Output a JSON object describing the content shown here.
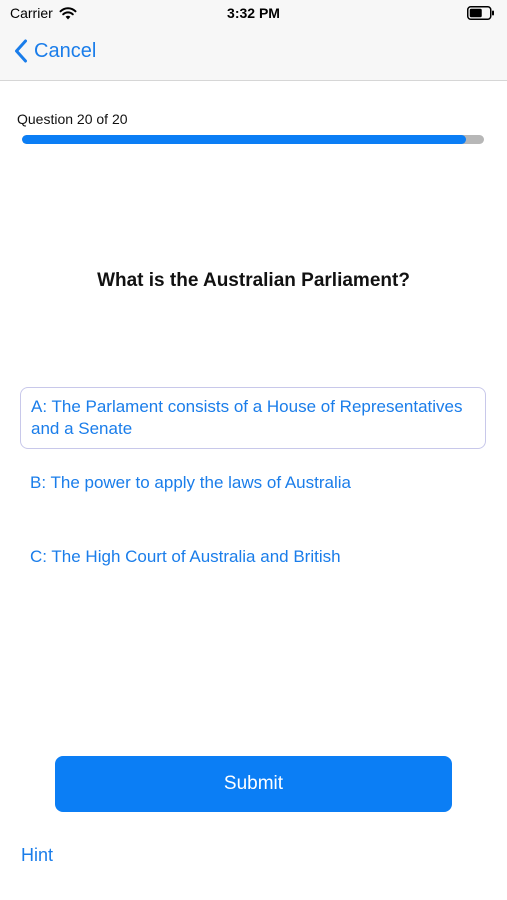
{
  "status_bar": {
    "carrier": "Carrier",
    "time": "3:32 PM",
    "wifi_icon": "wifi-icon",
    "battery_icon": "battery-icon"
  },
  "nav": {
    "back_icon": "chevron-left-icon",
    "cancel_label": "Cancel"
  },
  "progress": {
    "label": "Question 20 of 20",
    "current": 20,
    "total": 20,
    "fill_fraction": 0.96
  },
  "question": {
    "text": "What is the Australian Parliament?"
  },
  "answers": [
    {
      "label": "A: The Parlament consists of a House of Representatives and a Senate",
      "selected": true
    },
    {
      "label": "B: The power to apply the laws of Australia",
      "selected": false
    },
    {
      "label": "C: The High Court of Australia and British",
      "selected": false
    }
  ],
  "actions": {
    "submit_label": "Submit",
    "hint_label": "Hint"
  },
  "colors": {
    "accent": "#0b7ef5",
    "link": "#1a7dea",
    "track": "#b7b7b7"
  }
}
